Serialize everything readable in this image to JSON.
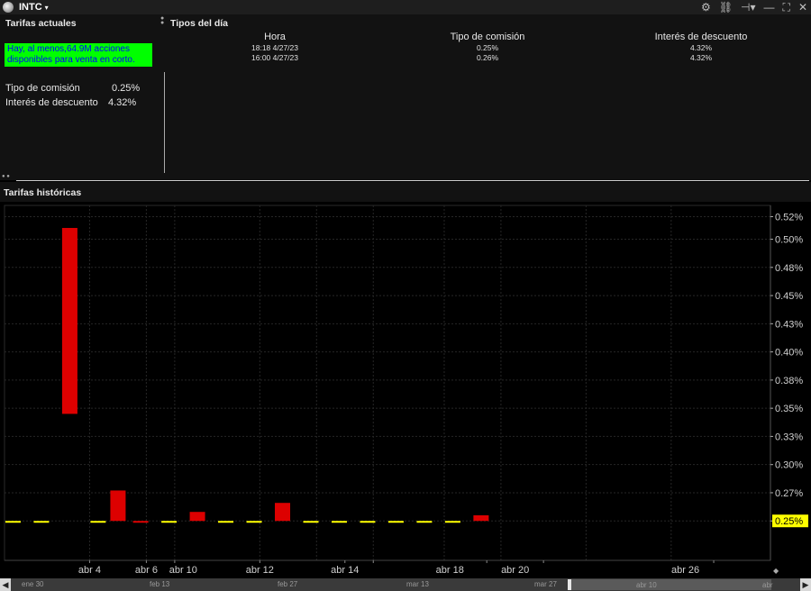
{
  "titlebar": {
    "symbol": "INTC",
    "caret": "▾",
    "icons": [
      "gear-icon",
      "link-icon",
      "pin-icon",
      "minimize-icon",
      "maximize-icon",
      "close-icon"
    ]
  },
  "current": {
    "section_title": "Tarifas actuales",
    "alert_line1": "Hay, al menos,64.9M acciones",
    "alert_line2": "disponibles para venta en corto.",
    "commission_label": "Tipo de comisión",
    "commission_value": "0.25%",
    "discount_label": "Interés de descuento",
    "discount_value": "4.32%"
  },
  "day": {
    "section_title": "Tipos del día",
    "headers": {
      "time": "Hora",
      "commission": "Tipo de comisión",
      "discount": "Interés de descuento"
    },
    "rows": [
      {
        "time": "18:18  4/27/23",
        "commission": "0.25%",
        "discount": "4.32%"
      },
      {
        "time": "16:00  4/27/23",
        "commission": "0.26%",
        "discount": "4.32%"
      }
    ]
  },
  "historical": {
    "section_title": "Tarifas históricas"
  },
  "chart_data": {
    "type": "bar",
    "ylim": [
      0.215,
      0.53
    ],
    "yticks": [
      0.25,
      0.275,
      0.3,
      0.325,
      0.35,
      0.375,
      0.4,
      0.425,
      0.45,
      0.475,
      0.5,
      0.52
    ],
    "ytick_labels": [
      "0.25%",
      "0.27%",
      "0.30%",
      "0.33%",
      "0.35%",
      "0.38%",
      "0.40%",
      "0.43%",
      "0.45%",
      "0.48%",
      "0.50%",
      "0.52%"
    ],
    "xlim": [
      1,
      28
    ],
    "xticks": [
      4,
      6,
      7,
      10,
      13,
      14,
      18,
      20,
      26
    ],
    "xtick_labels": [
      "abr 4",
      "abr 6",
      "abr 10",
      "abr 12",
      "abr 14",
      "abr 18",
      "abr 20",
      "abr 26"
    ],
    "xtick_label_days": [
      4,
      6,
      7.3,
      10,
      13,
      16.7,
      19,
      25
    ],
    "grid_days": [
      4,
      6,
      7,
      10,
      12,
      14,
      16.5,
      18.5,
      21.5,
      24.5
    ],
    "last_value": "0.25%",
    "bars": [
      {
        "day": 1.3,
        "low": 0.25,
        "high": 0.25,
        "color": "#ffff00"
      },
      {
        "day": 2.3,
        "low": 0.25,
        "high": 0.25,
        "color": "#ffff00"
      },
      {
        "day": 3.3,
        "low": 0.345,
        "high": 0.51,
        "color": "#dd0000"
      },
      {
        "day": 4.3,
        "low": 0.25,
        "high": 0.25,
        "color": "#ffff00"
      },
      {
        "day": 5.0,
        "low": 0.25,
        "high": 0.277,
        "color": "#dd0000"
      },
      {
        "day": 5.8,
        "low": 0.25,
        "high": 0.25,
        "color": "#dd0000"
      },
      {
        "day": 6.8,
        "low": 0.25,
        "high": 0.25,
        "color": "#ffff00"
      },
      {
        "day": 7.8,
        "low": 0.25,
        "high": 0.258,
        "color": "#dd0000"
      },
      {
        "day": 8.8,
        "low": 0.25,
        "high": 0.25,
        "color": "#ffff00"
      },
      {
        "day": 9.8,
        "low": 0.25,
        "high": 0.25,
        "color": "#ffff00"
      },
      {
        "day": 10.8,
        "low": 0.25,
        "high": 0.266,
        "color": "#dd0000"
      },
      {
        "day": 11.8,
        "low": 0.25,
        "high": 0.25,
        "color": "#ffff00"
      },
      {
        "day": 12.8,
        "low": 0.25,
        "high": 0.25,
        "color": "#ffff00"
      },
      {
        "day": 13.8,
        "low": 0.25,
        "high": 0.25,
        "color": "#ffff00"
      },
      {
        "day": 14.8,
        "low": 0.25,
        "high": 0.25,
        "color": "#ffff00"
      },
      {
        "day": 15.8,
        "low": 0.25,
        "high": 0.25,
        "color": "#ffff00"
      },
      {
        "day": 16.8,
        "low": 0.25,
        "high": 0.25,
        "color": "#ffff00"
      },
      {
        "day": 17.8,
        "low": 0.25,
        "high": 0.255,
        "color": "#dd0000"
      }
    ]
  },
  "scroller": {
    "labels": [
      "ene 30",
      "feb 13",
      "feb 27",
      "mar 13",
      "mar 27",
      "abr 10",
      "abr 24"
    ],
    "left_arrow": "◀",
    "right_arrow": "▶"
  }
}
